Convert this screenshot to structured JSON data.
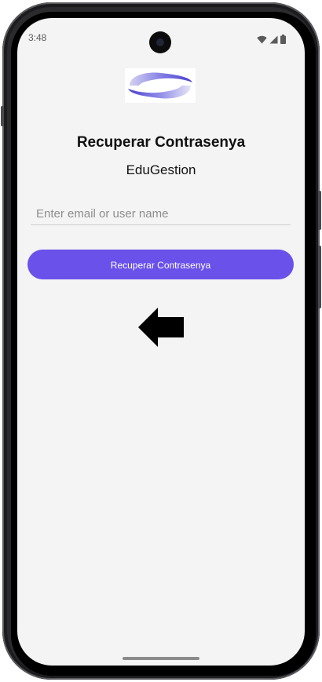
{
  "status_bar": {
    "time": "3:48",
    "icons": [
      "wifi-icon",
      "cellular-signal-icon",
      "battery-icon"
    ]
  },
  "logo": {
    "icon": "edugestion-logo-icon",
    "colors": [
      "#5a4fd6",
      "#8f8be8",
      "#c9c7ef"
    ]
  },
  "header": {
    "title": "Recuperar Contrasenya",
    "subtitle": "EduGestion"
  },
  "form": {
    "input_placeholder": "Enter email or user name",
    "input_value": "",
    "submit_label": "Recuperar Contrasenya"
  },
  "navigation": {
    "back_icon": "arrow-left-icon"
  },
  "colors": {
    "accent": "#6951ea",
    "background": "#f4f4f4"
  }
}
